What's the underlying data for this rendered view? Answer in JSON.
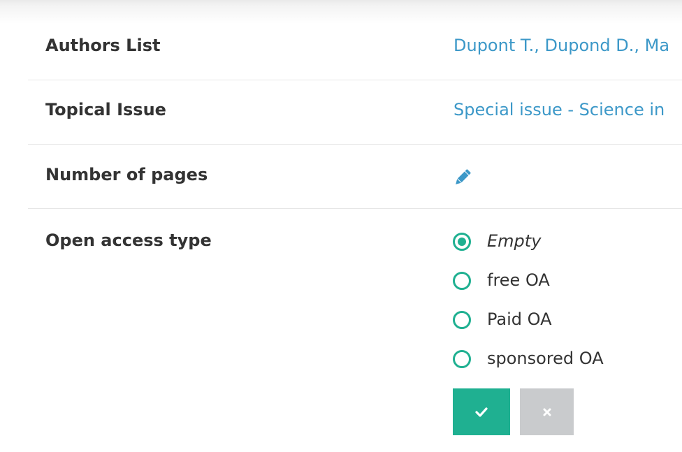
{
  "fields": [
    {
      "label": "Authors List",
      "value": "Dupont T., Dupond D., Ma"
    },
    {
      "label": "Topical Issue",
      "value": "Special issue - Science in"
    },
    {
      "label": "Number of pages",
      "icon": "pencil-icon"
    },
    {
      "label": "Open access type"
    }
  ],
  "open_access": {
    "options": [
      {
        "label": "Empty",
        "selected": true
      },
      {
        "label": "free OA",
        "selected": false
      },
      {
        "label": "Paid OA",
        "selected": false
      },
      {
        "label": "sponsored OA",
        "selected": false
      }
    ],
    "submit_icon": "check-icon",
    "cancel_icon": "close-icon"
  },
  "colors": {
    "link": "#3c98c8",
    "accent": "#1fb091",
    "cancel": "#c9cbcd",
    "divider": "#e6e6e6"
  }
}
